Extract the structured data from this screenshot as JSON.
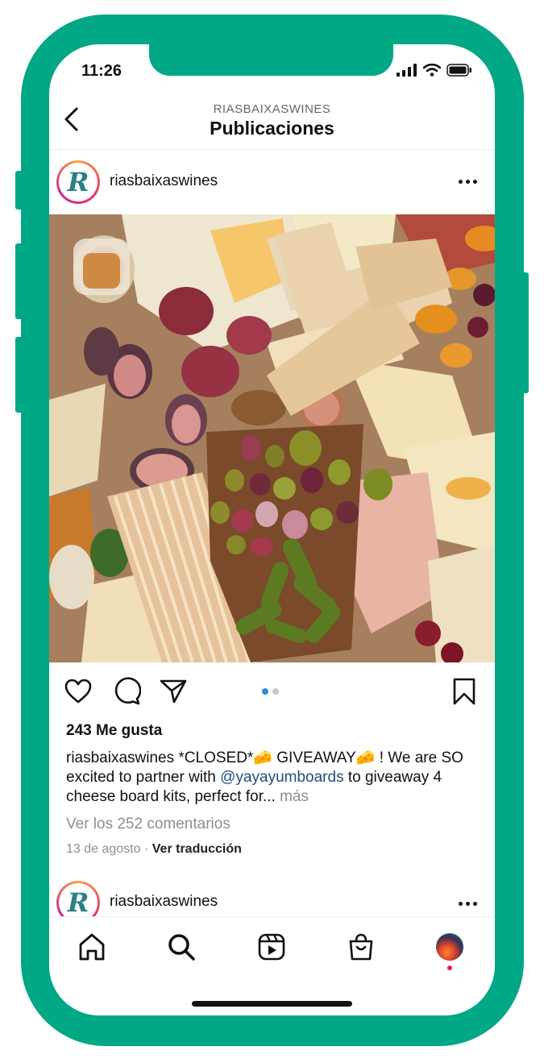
{
  "status": {
    "time": "11:26"
  },
  "header": {
    "account": "RIASBAIXASWINES",
    "title": "Publicaciones"
  },
  "post": {
    "username": "riasbaixaswines",
    "likes": "243 Me gusta",
    "caption": {
      "username": "riasbaixaswines",
      "text_part1": " *CLOSED*🧀 GIVEAWAY🧀 ! We are SO excited to partner with ",
      "mention": "@yayayumboards",
      "text_part2": " to giveaway 4 cheese board kits, perfect for...",
      "more": "más"
    },
    "comments": "Ver los 252 comentarios",
    "date": "13 de agosto",
    "translate": "Ver traducción",
    "carousel": {
      "count": 2,
      "active": 1
    }
  },
  "next_post": {
    "username": "riasbaixaswines"
  },
  "colors": {
    "frame": "#00a886",
    "mention": "#1f4f7a",
    "carousel_active": "#2f86e0"
  },
  "icons": [
    "back-chevron-icon",
    "heart-icon",
    "comment-icon",
    "share-icon",
    "bookmark-icon",
    "home-icon",
    "search-icon",
    "reels-icon",
    "shop-icon"
  ]
}
